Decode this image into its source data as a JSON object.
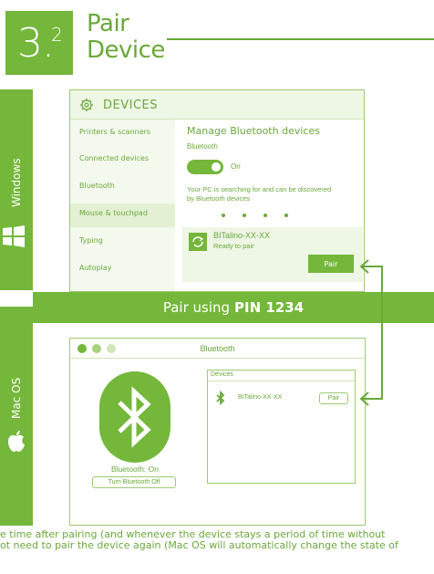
{
  "section": {
    "number": "3.",
    "sup": "2",
    "title_line1": "Pair",
    "title_line2": "Device"
  },
  "side": {
    "windows": "Windows",
    "mac": "Mac OS"
  },
  "windows": {
    "header": "DEVICES",
    "nav": [
      "Printers & scanners",
      "Connected devices",
      "Bluetooth",
      "Mouse & touchpad",
      "Typing",
      "Autoplay"
    ],
    "manage_title": "Manage Bluetooth devices",
    "bluetooth_label": "Bluetooth",
    "toggle_state": "On",
    "search_text_1": "Your PC is searching for and can be discovered",
    "search_text_2": "by Bluetooth devices",
    "device_name": "BITalino-XX-XX",
    "device_status": "Ready to pair",
    "pair_button": "Pair"
  },
  "banner": {
    "prefix": "Pair using",
    "pin": "PIN 1234"
  },
  "mac": {
    "window_title": "Bluetooth",
    "status": "Bluetooth: On",
    "turn_off_button": "Turn Bluetooth Off",
    "devices_header": "Devices",
    "device_name": "BITalino-XX-XX",
    "pair_button": "Pair"
  },
  "body": {
    "line1": "e time after pairing (and whenever the device stays a period of time without",
    "line2": "ot need to pair the device again (Mac OS will automatically change the state of"
  },
  "colors": {
    "accent": "#74b73a",
    "light": "#eef6e5"
  }
}
